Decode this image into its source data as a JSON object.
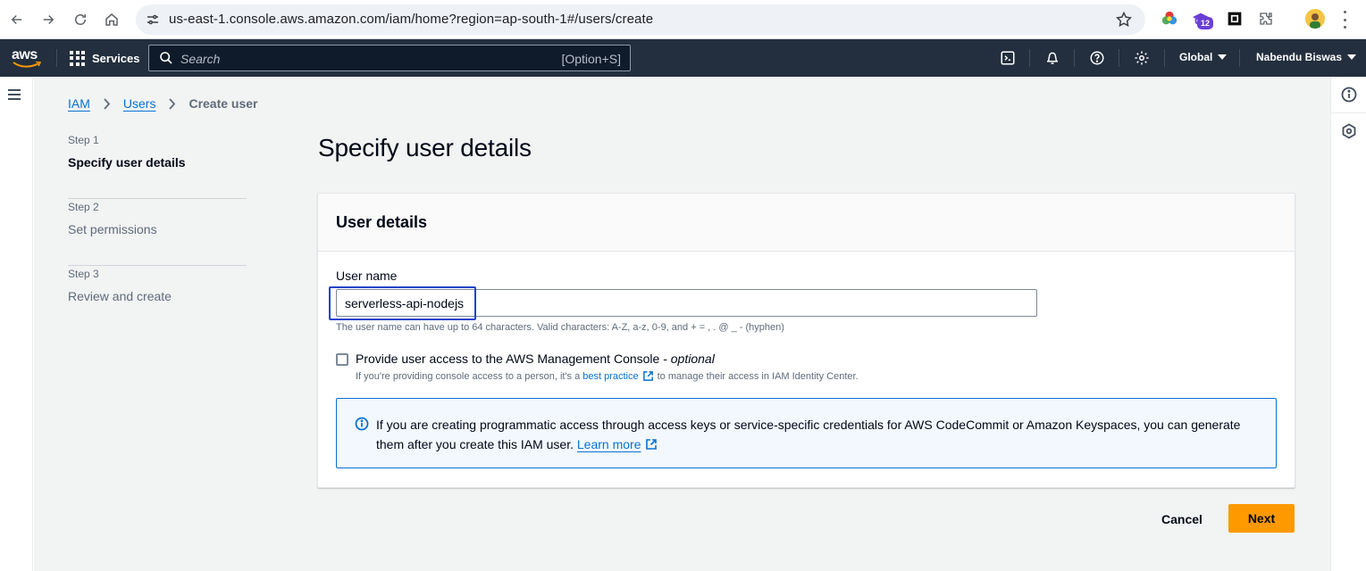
{
  "browser": {
    "url": "us-east-1.console.aws.amazon.com/iam/home?region=ap-south-1#/users/create",
    "extension_badge": "12",
    "icons": [
      "back-icon",
      "forward-icon",
      "reload-icon",
      "home-icon",
      "site-settings-icon",
      "bookmark-star-icon",
      "extensions-puzzle-icon",
      "profile-avatar",
      "menu-kebab-icon"
    ]
  },
  "aws_nav": {
    "logo": "aws",
    "services_label": "Services",
    "search_placeholder": "Search",
    "search_shortcut": "[Option+S]",
    "region_label": "Global",
    "user_label": "Nabendu Biswas",
    "icons": [
      "cloudshell-icon",
      "notifications-bell-icon",
      "help-icon",
      "settings-gear-icon"
    ]
  },
  "breadcrumb": {
    "items": [
      {
        "label": "IAM"
      },
      {
        "label": "Users"
      }
    ],
    "current": "Create user"
  },
  "steps": [
    {
      "label": "Step 1",
      "title": "Specify user details",
      "active": true
    },
    {
      "label": "Step 2",
      "title": "Set permissions",
      "active": false
    },
    {
      "label": "Step 3",
      "title": "Review and create",
      "active": false
    }
  ],
  "page_title": "Specify user details",
  "panel": {
    "title": "User details",
    "username_label": "User name",
    "username_value": "serverless-api-nodejs",
    "username_hint": "The user name can have up to 64 characters. Valid characters: A-Z, a-z, 0-9, and + = , . @ _ - (hyphen)",
    "console_access_label": "Provide user access to the AWS Management Console - ",
    "console_access_optional": "optional",
    "console_access_desc_before": "If you're providing console access to a person, it's a",
    "console_access_desc_link": "best practice",
    "console_access_desc_after": "to manage their access in IAM Identity Center.",
    "console_access_checked": false,
    "info_text": "If you are creating programmatic access through access keys or service-specific credentials for AWS CodeCommit or Amazon Keyspaces, you can generate them after you create this IAM user.",
    "info_link": "Learn more"
  },
  "actions": {
    "cancel_label": "Cancel",
    "next_label": "Next"
  },
  "colors": {
    "aws_nav_bg": "#232f3e",
    "link_blue": "#0972d3",
    "primary_button": "#ff9900",
    "content_bg": "#f2f3f3",
    "highlight_box": "#2244cc"
  }
}
